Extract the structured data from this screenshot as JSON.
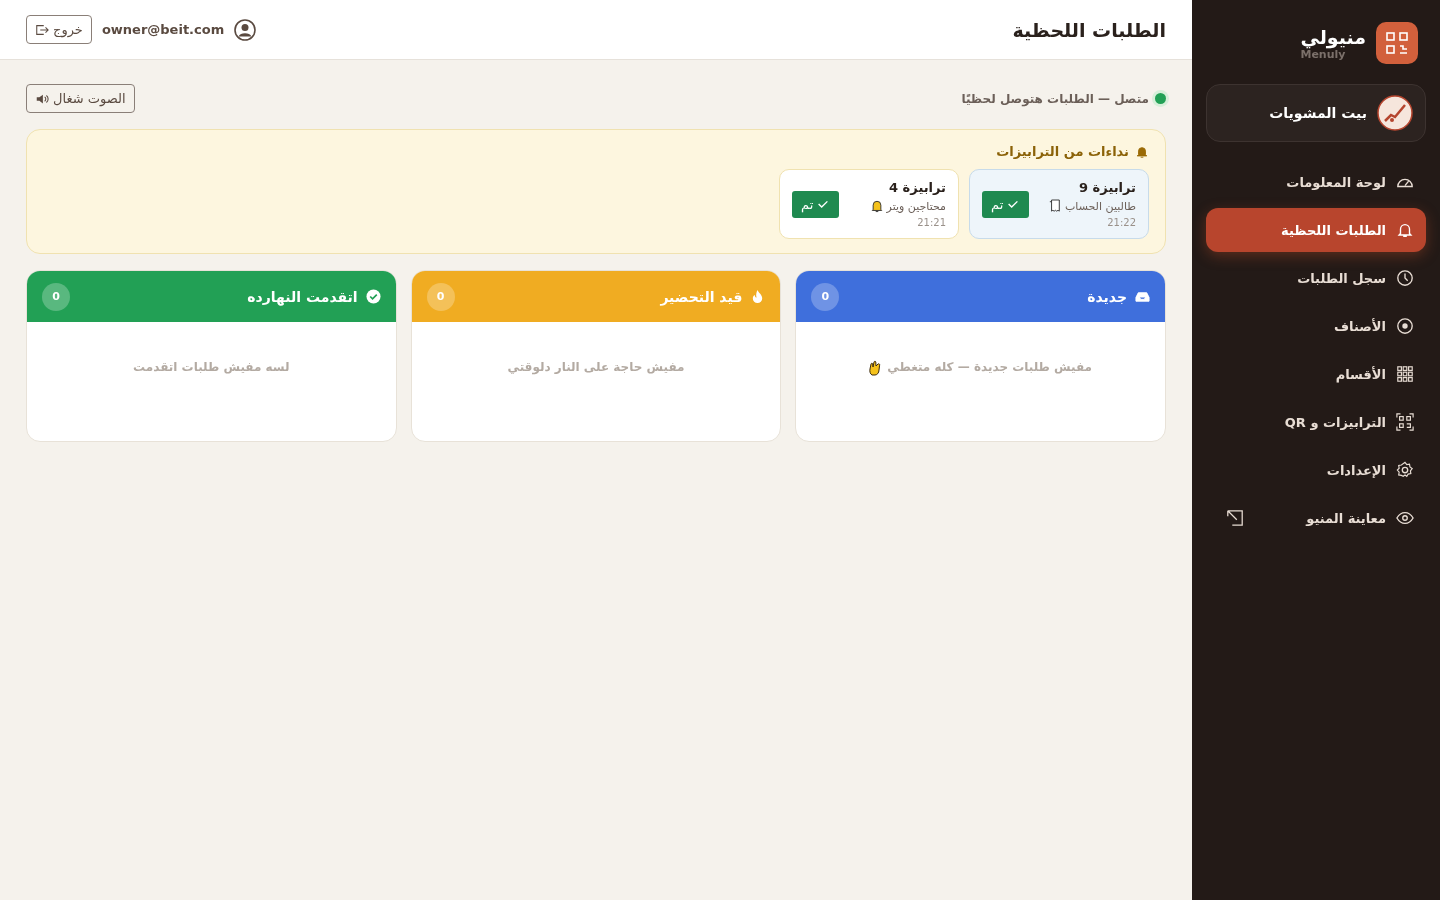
{
  "brand": {
    "name": "منيولي",
    "subtitle": "Menuly"
  },
  "restaurant": {
    "name": "بيت المشويات"
  },
  "nav": [
    {
      "label": "لوحة المعلومات",
      "kind": "gauge",
      "selected": false,
      "external": false
    },
    {
      "label": "الطلبات اللحظية",
      "kind": "bell",
      "selected": true,
      "external": false
    },
    {
      "label": "سجل الطلبات",
      "kind": "clock",
      "selected": false,
      "external": false
    },
    {
      "label": "الأصناف",
      "kind": "dish",
      "selected": false,
      "external": false
    },
    {
      "label": "الأقسام",
      "kind": "grid",
      "selected": false,
      "external": false
    },
    {
      "label": "الترابيزات و QR",
      "kind": "qr",
      "selected": false,
      "external": false
    },
    {
      "label": "الإعدادات",
      "kind": "gear",
      "selected": false,
      "external": false
    },
    {
      "label": "معاينة المنيو",
      "kind": "eye",
      "selected": false,
      "external": true
    }
  ],
  "header": {
    "title": "الطلبات اللحظية",
    "email": "owner@beit.com",
    "logout": "خروج"
  },
  "status": {
    "text": "متصل — الطلبات هتوصل لحظيًا",
    "connected": true
  },
  "sound_button": {
    "label": "الصوت شغال",
    "on": true
  },
  "calls": {
    "title": "نداءات من الترابيزات",
    "items": [
      {
        "table": "ترابيزة 9",
        "reason": "طالبين الحساب",
        "kind": "bill",
        "time": "21:22",
        "done_label": "تم",
        "highlighted": true
      },
      {
        "table": "ترابيزة 4",
        "reason": "محتاجين ويتر",
        "kind": "waiter",
        "time": "21:21",
        "done_label": "تم",
        "highlighted": false
      }
    ]
  },
  "columns": [
    {
      "title": "جديدة",
      "kind": "new",
      "color": "#3f6fdc",
      "count": "0",
      "empty": "مفيش طلبات جديدة — كله متغطي",
      "empty_icon": true
    },
    {
      "title": "قيد التحضير",
      "kind": "preparing",
      "color": "#f0ac22",
      "count": "0",
      "empty": "مفيش حاجة على النار دلوقتي",
      "empty_icon": false
    },
    {
      "title": "اتقدمت النهارده",
      "kind": "done",
      "color": "#22a055",
      "count": "0",
      "empty": "لسه مفيش طلبات اتقدمت",
      "empty_icon": false
    }
  ]
}
